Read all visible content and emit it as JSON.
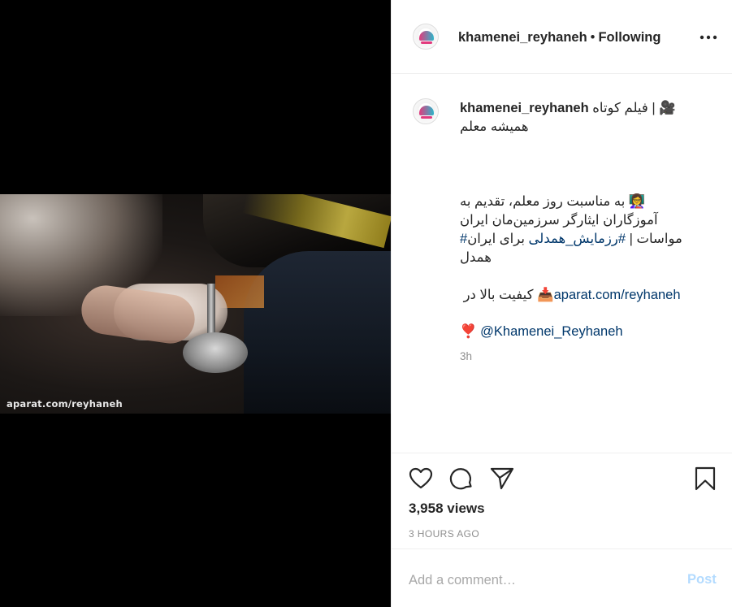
{
  "media": {
    "watermark": "aparat.com/reyhaneh"
  },
  "header": {
    "username": "khamenei_reyhaneh",
    "separator": "•",
    "follow_status": "Following",
    "more_icon": "more-horizontal-icon"
  },
  "caption": {
    "username": "khamenei_reyhaneh",
    "title_line1": "🎥 | فیلم کوتاه",
    "title_line2": "همیشه معلم",
    "para1_line1": "👩‍🏫 به مناسبت روز معلم، تقدیم به",
    "para1_line2": "آموزگاران ایثارگر سرزمین‌مان ایران",
    "para1_line3_text": "مواسات | ",
    "para1_line3_hashtag": "#رزمایش_همدلی",
    "para1_line3_text2": " برای ایران",
    "para1_line3_hashtag2": "#",
    "para1_line4": "همدل",
    "para2_prefix": "📥 کیفیت بالا در ",
    "para2_link": "aparat.com/reyhaneh",
    "para3_emoji": "❣️",
    "para3_link": "@Khamenei_Reyhaneh",
    "time": "3h"
  },
  "actions": {
    "like_icon": "heart-icon",
    "comment_icon": "comment-icon",
    "share_icon": "send-icon",
    "save_icon": "bookmark-icon",
    "views": "3,958 views",
    "posted_ago": "3 HOURS AGO"
  },
  "comment_box": {
    "placeholder": "Add a comment…",
    "post_label": "Post"
  }
}
